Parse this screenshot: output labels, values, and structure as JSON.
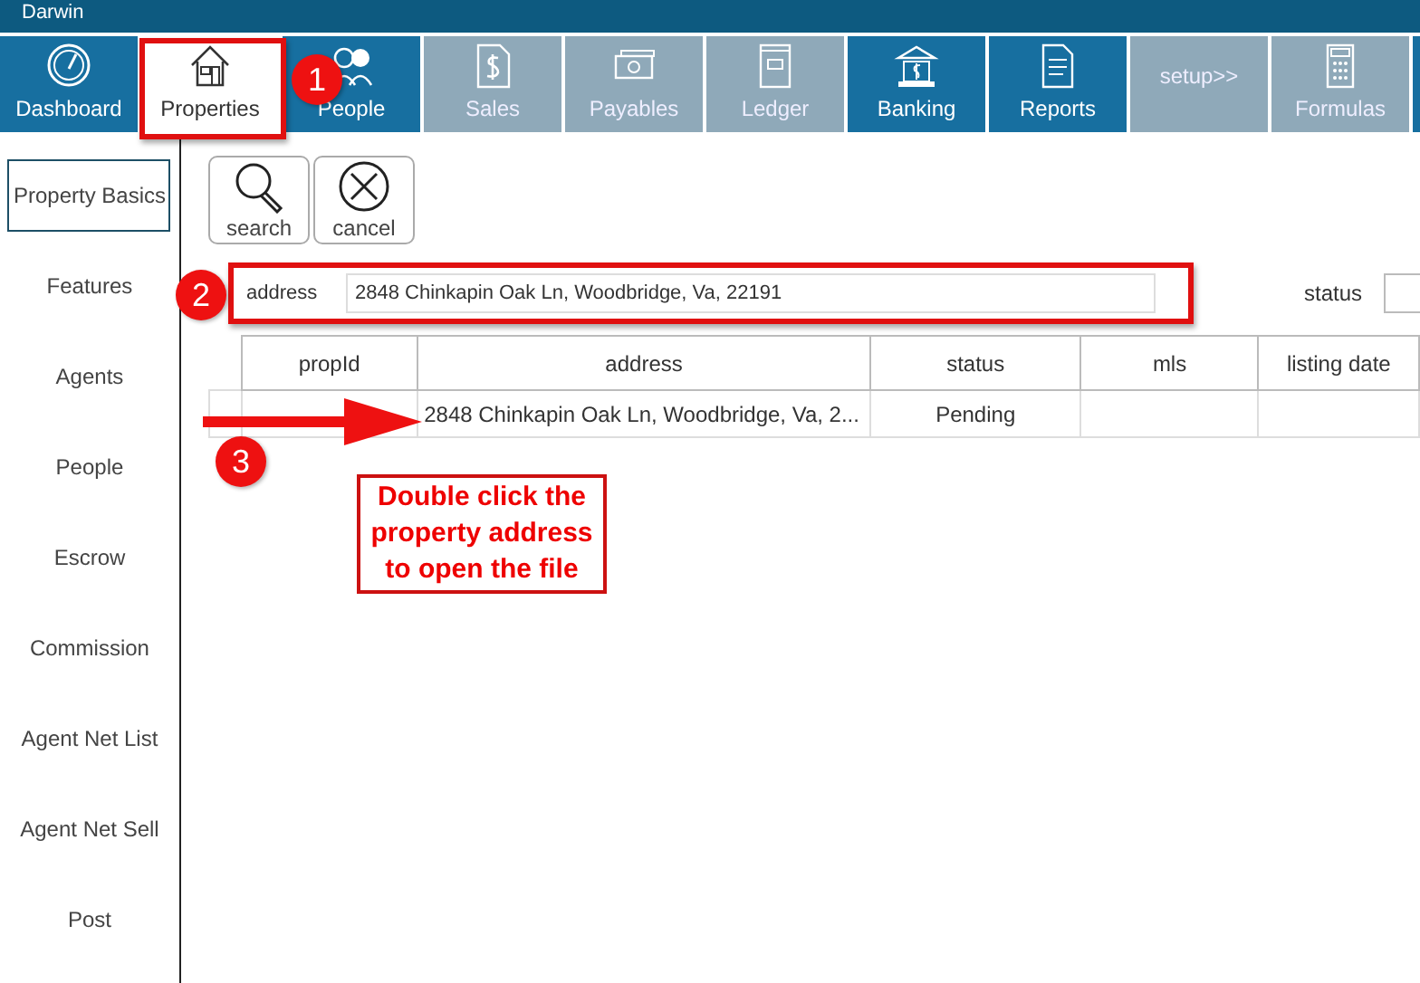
{
  "window": {
    "title": "Darwin"
  },
  "tabs": [
    {
      "label": "Dashboard",
      "selected": false,
      "disabled": false
    },
    {
      "label": "Properties",
      "selected": true,
      "disabled": false
    },
    {
      "label": "People",
      "selected": false,
      "disabled": false
    },
    {
      "label": "Sales",
      "selected": false,
      "disabled": true
    },
    {
      "label": "Payables",
      "selected": false,
      "disabled": true
    },
    {
      "label": "Ledger",
      "selected": false,
      "disabled": true
    },
    {
      "label": "Banking",
      "selected": false,
      "disabled": false
    },
    {
      "label": "Reports",
      "selected": false,
      "disabled": false
    },
    {
      "label": "setup>>",
      "selected": false,
      "disabled": true
    },
    {
      "label": "Formulas",
      "selected": false,
      "disabled": true
    }
  ],
  "sidebar": {
    "items": [
      {
        "label": "Property Basics",
        "selected": true
      },
      {
        "label": "Features",
        "selected": false
      },
      {
        "label": "Agents",
        "selected": false
      },
      {
        "label": "People",
        "selected": false
      },
      {
        "label": "Escrow",
        "selected": false
      },
      {
        "label": "Commission",
        "selected": false
      },
      {
        "label": "Agent Net List",
        "selected": false
      },
      {
        "label": "Agent Net Sell",
        "selected": false
      },
      {
        "label": "Post",
        "selected": false
      }
    ]
  },
  "toolbar": [
    {
      "label": "search",
      "kind": "search"
    },
    {
      "label": "cancel",
      "kind": "cancel"
    }
  ],
  "filter": {
    "label": "address",
    "value": "2848 Chinkapin Oak Ln, Woodbridge, Va, 22191",
    "status_label": "status"
  },
  "table": {
    "columns": [
      "propId",
      "address",
      "status",
      "mls",
      "listing date"
    ],
    "rows": [
      {
        "cells": [
          "",
          "2848 Chinkapin Oak Ln, Woodbridge, Va, 2...",
          "Pending",
          "",
          ""
        ]
      }
    ]
  },
  "annotations": {
    "markers": [
      "1",
      "2",
      "3"
    ],
    "note": "Double click the property address to open the file"
  }
}
